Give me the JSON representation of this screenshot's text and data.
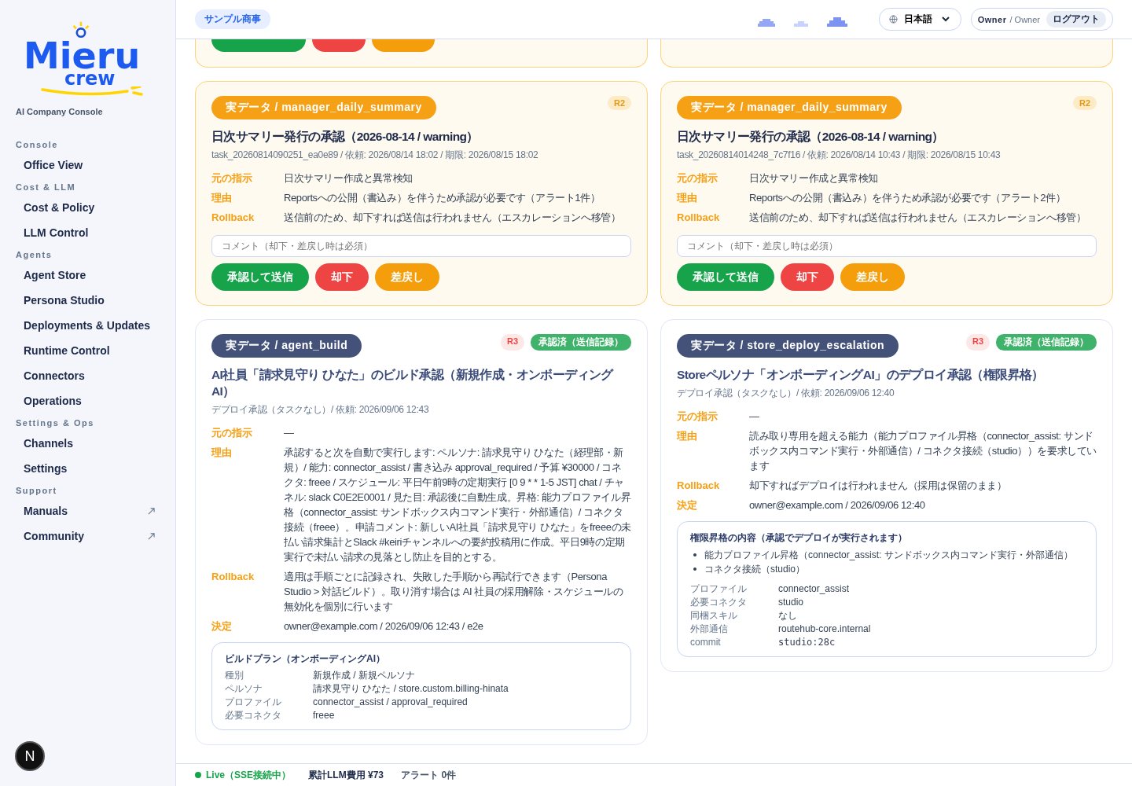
{
  "sidebar": {
    "logo": {
      "top": "Mieru",
      "bottom": "crew"
    },
    "subtitle": "AI Company Console",
    "sections": [
      {
        "title": "Console",
        "items": [
          {
            "label": "Office View",
            "external": false
          }
        ]
      },
      {
        "title": "Cost & LLM",
        "items": [
          {
            "label": "Cost & Policy",
            "external": false
          },
          {
            "label": "LLM Control",
            "external": false
          }
        ]
      },
      {
        "title": "Agents",
        "items": [
          {
            "label": "Agent Store",
            "external": false
          },
          {
            "label": "Persona Studio",
            "external": false
          },
          {
            "label": "Deployments & Updates",
            "external": false
          },
          {
            "label": "Runtime Control",
            "external": false
          },
          {
            "label": "Connectors",
            "external": false
          },
          {
            "label": "Operations",
            "external": false
          }
        ]
      },
      {
        "title": "Settings & Ops",
        "items": [
          {
            "label": "Channels",
            "external": false
          },
          {
            "label": "Settings",
            "external": false
          }
        ]
      },
      {
        "title": "Support",
        "items": [
          {
            "label": "Manuals",
            "external": true
          },
          {
            "label": "Community",
            "external": true
          }
        ]
      }
    ],
    "dev_badge": "N"
  },
  "header": {
    "company": "サンプル商事",
    "language": "日本語",
    "user": "Owner",
    "role": "/ Owner",
    "logout": "ログアウト"
  },
  "partial_cards": [
    {
      "kind": "pending",
      "buttons": [
        {
          "kind": "approve"
        },
        {
          "kind": "reject"
        },
        {
          "kind": "return"
        }
      ]
    },
    {
      "kind": "pending"
    }
  ],
  "cards": [
    {
      "kind": "pending",
      "tag": "実データ / manager_daily_summary",
      "risk": "R2",
      "title": "日次サマリー発行の承認（2026-08-14 / warning）",
      "meta": "task_20260814090251_ea0e89 / 依頼: 2026/08/14 18:02 / 期限: 2026/08/15 18:02",
      "rows": [
        {
          "label": "元の指示",
          "value": "日次サマリー作成と異常検知"
        },
        {
          "label": "理由",
          "value": "Reportsへの公開（書込み）を伴うため承認が必要です（アラート1件）"
        },
        {
          "label": "Rollback",
          "value": "送信前のため、却下すれば送信は行われません（エスカレーションへ移管）"
        }
      ],
      "comment_placeholder": "コメント（却下・差戻し時は必須）",
      "buttons": [
        {
          "kind": "approve",
          "label": "承認して送信"
        },
        {
          "kind": "reject",
          "label": "却下"
        },
        {
          "kind": "return",
          "label": "差戻し"
        }
      ]
    },
    {
      "kind": "pending",
      "tag": "実データ / manager_daily_summary",
      "risk": "R2",
      "title": "日次サマリー発行の承認（2026-08-14 / warning）",
      "meta": "task_20260814014248_7c7f16 / 依頼: 2026/08/14 10:43 / 期限: 2026/08/15 10:43",
      "rows": [
        {
          "label": "元の指示",
          "value": "日次サマリー作成と異常検知"
        },
        {
          "label": "理由",
          "value": "Reportsへの公開（書込み）を伴うため承認が必要です（アラート2件）"
        },
        {
          "label": "Rollback",
          "value": "送信前のため、却下すれば送信は行われません（エスカレーションへ移管）"
        }
      ],
      "comment_placeholder": "コメント（却下・差戻し時は必須）",
      "buttons": [
        {
          "kind": "approve",
          "label": "承認して送信"
        },
        {
          "kind": "reject",
          "label": "却下"
        },
        {
          "kind": "return",
          "label": "差戻し"
        }
      ]
    },
    {
      "kind": "approved",
      "tag": "実データ / agent_build",
      "risk": "R3",
      "badge": "承認済（送信記録）",
      "title": "AI社員「請求見守り ひなた」のビルド承認（新規作成・オンボーディングAI）",
      "meta": "デプロイ承認（タスクなし）/ 依頼: 2026/09/06 12:43",
      "rows": [
        {
          "label": "元の指示",
          "value": "—"
        },
        {
          "label": "理由",
          "value": "承認すると次を自動で実行します: ペルソナ: 請求見守り ひなた（経理部・新規）/ 能力: connector_assist / 書き込み approval_required / 予算 ¥30000 / コネクタ: freee / スケジュール: 平日午前9時の定期実行 [0 9 * * 1-5 JST] chat / チャネル: slack C0E2E0001 / 見た目: 承認後に自動生成。昇格: 能力プロファイル昇格（connector_assist: サンドボックス内コマンド実行・外部通信）/ コネクタ接続（freee）。申請コメント: 新しいAI社員「請求見守り ひなた」をfreeeの未払い請求集計とSlack #keiriチャンネルへの要約投稿用に作成。平日9時の定期実行で未払い請求の見落とし防止を目的とする。"
        },
        {
          "label": "Rollback",
          "value": "適用は手順ごとに記録され、失敗した手順から再試行できます（Persona Studio > 対話ビルド）。取り消す場合は AI 社員の採用解除・スケジュールの無効化を個別に行います"
        },
        {
          "label": "決定",
          "value": "owner@example.com / 2026/09/06 12:43 / e2e"
        }
      ],
      "detail": {
        "title": "ビルドプラン（オンボーディングAI）",
        "rows": [
          {
            "kind": "text",
            "label": "種別",
            "value": "新規作成 / 新規ペルソナ"
          },
          {
            "kind": "text",
            "label": "ペルソナ",
            "value": "請求見守り ひなた / store.custom.billing-hinata"
          },
          {
            "kind": "text",
            "label": "プロファイル",
            "value": "connector_assist / approval_required"
          },
          {
            "kind": "text",
            "label": "必要コネクタ",
            "value": "freee"
          }
        ]
      }
    },
    {
      "kind": "approved",
      "tag": "実データ / store_deploy_escalation",
      "risk": "R3",
      "badge": "承認済（送信記録）",
      "title": "Storeペルソナ「オンボーディングAI」のデプロイ承認（権限昇格）",
      "meta": "デプロイ承認（タスクなし）/ 依頼: 2026/09/06 12:40",
      "rows": [
        {
          "label": "元の指示",
          "value": "—"
        },
        {
          "label": "理由",
          "value": "読み取り専用を超える能力（能力プロファイル昇格（connector_assist: サンドボックス内コマンド実行・外部通信）/ コネクタ接続（studio））を要求しています"
        },
        {
          "label": "Rollback",
          "value": "却下すればデプロイは行われません（採用は保留のまま）"
        },
        {
          "label": "決定",
          "value": "owner@example.com / 2026/09/06 12:40"
        }
      ],
      "detail": {
        "title": "権限昇格の内容（承認でデプロイが実行されます）",
        "bullets": [
          "能力プロファイル昇格（connector_assist: サンドボックス内コマンド実行・外部通信）",
          "コネクタ接続（studio）"
        ],
        "rows": [
          {
            "kind": "text",
            "label": "プロファイル",
            "value": "connector_assist"
          },
          {
            "kind": "text",
            "label": "必要コネクタ",
            "value": "studio"
          },
          {
            "kind": "text",
            "label": "同梱スキル",
            "value": "なし"
          },
          {
            "kind": "text",
            "label": "外部通信",
            "value": "routehub-core.internal"
          },
          {
            "kind": "code",
            "label": "commit",
            "value": "studio:28c"
          }
        ]
      }
    }
  ],
  "status_bar": {
    "live": true,
    "live_label": "Live（SSE接続中）",
    "cost": "累計LLM費用 ¥73",
    "alerts": "アラート 0件"
  }
}
